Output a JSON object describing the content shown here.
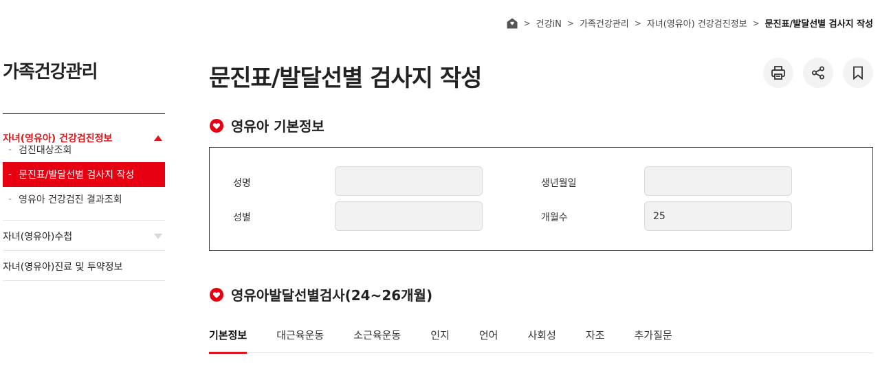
{
  "breadcrumb": {
    "items": [
      "건강iN",
      "가족건강관리",
      "자녀(영유아) 건강검진정보",
      "문진표/발달선별 검사지 작성"
    ]
  },
  "sidebar": {
    "title": "가족건강관리",
    "group1": {
      "label": "자녀(영유아) 건강검진정보",
      "items": [
        "검진대상조회",
        "문진표/발달선별 검사지 작성",
        "영유아 건강검진 결과조회"
      ]
    },
    "group2": {
      "label": "자녀(영유아)수첩"
    },
    "group3": {
      "label": "자녀(영유아)진료 및 투약정보"
    }
  },
  "main": {
    "title": "문진표/발달선별 검사지 작성",
    "section1_title": "영유아 기본정보",
    "fields": {
      "name_label": "성명",
      "name_value": "",
      "birth_label": "생년월일",
      "birth_value": "",
      "sex_label": "성별",
      "sex_value": "",
      "months_label": "개월수",
      "months_value": "25"
    },
    "section2_title": "영유아발달선별검사(24~26개월)",
    "tabs": [
      "기본정보",
      "대근육운동",
      "소근육운동",
      "인지",
      "언어",
      "사회성",
      "자조",
      "추가질문"
    ]
  },
  "colors": {
    "accent": "#e60012",
    "text": "#222222",
    "input_bg": "#f2f2f2"
  },
  "icons": {
    "home": "home-icon",
    "print": "print-icon",
    "share": "share-icon",
    "bookmark": "bookmark-icon",
    "section": "heart-badge-icon"
  }
}
